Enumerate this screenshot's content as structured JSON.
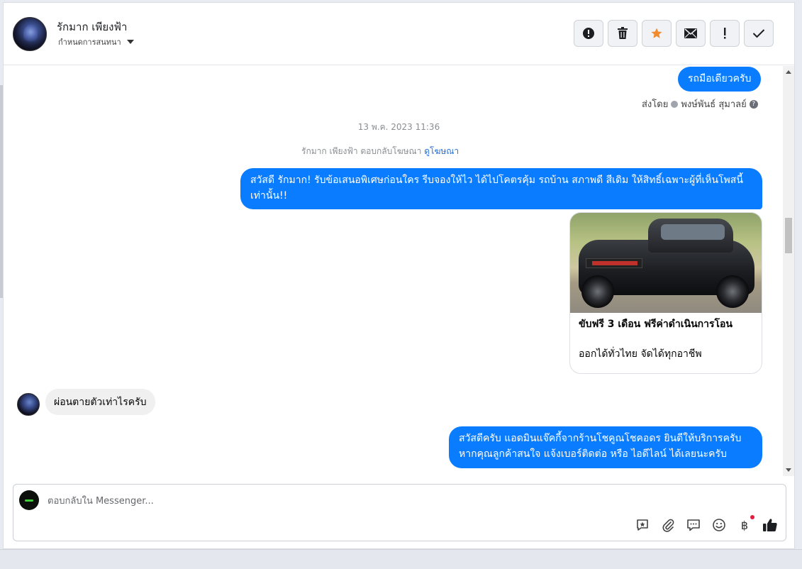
{
  "header": {
    "contact_name": "รักมาก เพียงฟ้า",
    "assign_label": "กำหนดการสนทนา",
    "actions": [
      "mark-spam",
      "delete",
      "star",
      "mark-unread",
      "follow-up",
      "mark-done"
    ]
  },
  "messages": {
    "m1_text": "รถมือเดียวครับ",
    "sent_by_prefix": "ส่งโดย",
    "sent_by_name": "พงษ์พันธ์ สุมาลย์",
    "timestamp": "13 พ.ค. 2023 11:36",
    "reply_note": "รักมาก เพียงฟ้า ตอบกลับโฆษณา",
    "reply_note_link": "ดูโฆษณา",
    "m2_text": "สวัสดี รักมาก! รับข้อเสนอพิเศษก่อนใคร รีบจองให้ไว ได้ไปโคตรคุ้ม รถบ้าน สภาพดี สีเดิม ให้สิทธิ์เฉพาะผู้ที่เห็นโพสนี้เท่านั้น!!",
    "ad_title": "ขับฟรี 3 เดือน ฟรีค่าดำเนินการโอน",
    "ad_subtitle": "ออกได้ทั่วไทย จัดได้ทุกอาชีพ",
    "m3_text": "ผ่อนตายตัวเท่าไรครับ",
    "m4_text": "สวัสดีครับ แอดมินแจ๊คกี้จากร้านโชคูณโชคอดร ยินดีให้บริการครับ หากคุณลูกค้าสนใจ แจ้งเบอร์ติดต่อ หรือ ไอดีไลน์ ได้เลยนะครับ"
  },
  "composer": {
    "placeholder": "ตอบกลับใน Messenger...",
    "baht_symbol": "฿"
  },
  "colors": {
    "outgoing_bubble": "#0a7cff",
    "incoming_bubble": "#f0f0f0",
    "star": "#f08c2e"
  }
}
